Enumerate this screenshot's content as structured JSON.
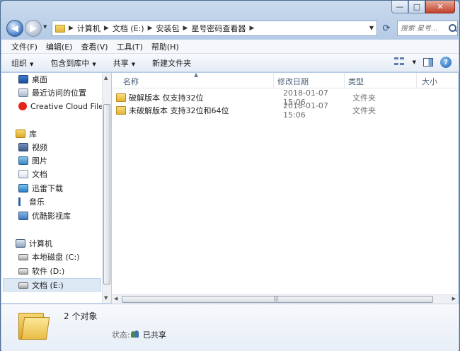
{
  "window": {
    "minimize": "—",
    "maximize": "□",
    "close": "✕"
  },
  "address": {
    "crumbs": [
      "计算机",
      "文档 (E:)",
      "安装包",
      "星号密码查看器"
    ],
    "search_placeholder": "搜索 星号..."
  },
  "menu": [
    "文件(F)",
    "编辑(E)",
    "查看(V)",
    "工具(T)",
    "帮助(H)"
  ],
  "toolbar": {
    "organize": "组织",
    "include": "包含到库中",
    "share": "共享",
    "new_folder": "新建文件夹"
  },
  "nav": {
    "favorites": [
      "桌面",
      "最近访问的位置",
      "Creative Cloud File"
    ],
    "libraries_header": "库",
    "libraries": [
      "视频",
      "图片",
      "文档",
      "迅雷下载",
      "音乐",
      "优酷影视库"
    ],
    "computer_header": "计算机",
    "drives": [
      "本地磁盘 (C:)",
      "软件 (D:)",
      "文档 (E:)"
    ]
  },
  "columns": {
    "name": "名称",
    "date": "修改日期",
    "type": "类型",
    "size": "大小"
  },
  "files": [
    {
      "name": "破解版本 仅支持32位",
      "date": "2018-01-07 15:06",
      "type": "文件夹"
    },
    {
      "name": "未破解版本 支持32位和64位",
      "date": "2018-01-07 15:06",
      "type": "文件夹"
    }
  ],
  "details": {
    "count": "2 个对象",
    "status_label": "状态:",
    "status_value": "已共享"
  }
}
